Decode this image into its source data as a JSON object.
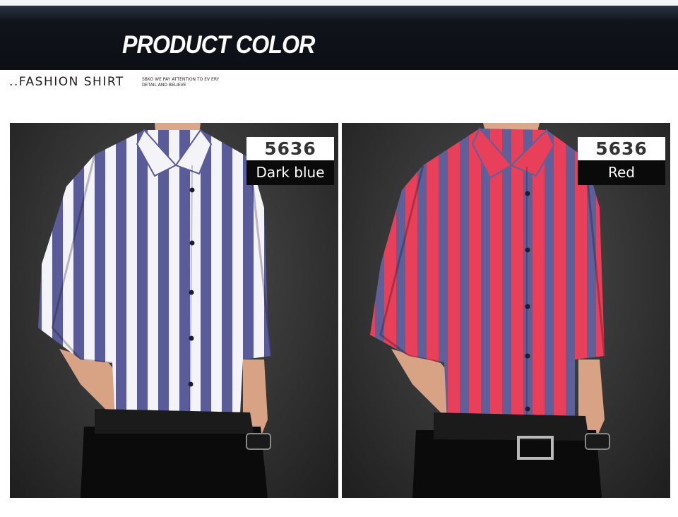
{
  "header": {
    "title": "PRODUCT COLOR"
  },
  "intro": {
    "subtitle": "..FASHION SHIRT",
    "tagline": "SBKO WE PAY ATTENTION TO EV ERY DETAIL AND BELIEVE"
  },
  "products": [
    {
      "code": "5636",
      "color_name": "Dark blue",
      "stripe_primary": "#5a5c9a",
      "stripe_secondary": "#f4f4f8"
    },
    {
      "code": "5636",
      "color_name": "Red",
      "stripe_primary": "#e8405a",
      "stripe_secondary": "#5f5f9a"
    }
  ]
}
